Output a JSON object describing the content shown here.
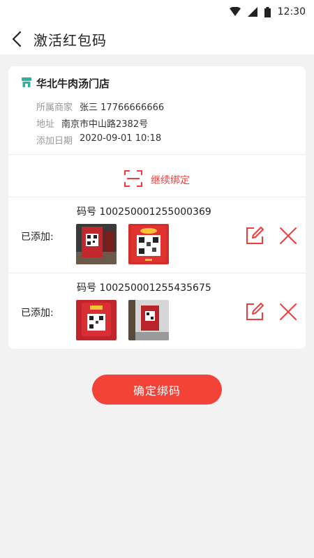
{
  "status_bar": {
    "time": "12:30"
  },
  "nav": {
    "title": "激活红包码"
  },
  "store": {
    "name": "华北牛肉汤门店",
    "merchant_label": "所属商家",
    "merchant_value": "张三 17766666666",
    "address_label": "地址",
    "address_value": "南京市中山路2382号",
    "date_label": "添加日期",
    "date_value": "2020-09-01 10:18"
  },
  "continue_bind": {
    "label": "继续绑定"
  },
  "codes": [
    {
      "title": "码号 100250001255000369",
      "added_label": "已添加:"
    },
    {
      "title": "码号 100250001255435675",
      "added_label": "已添加:"
    }
  ],
  "confirm_button": {
    "label": "确定绑码"
  },
  "colors": {
    "accent": "#f34238",
    "store_icon": "#2bb3a0"
  }
}
